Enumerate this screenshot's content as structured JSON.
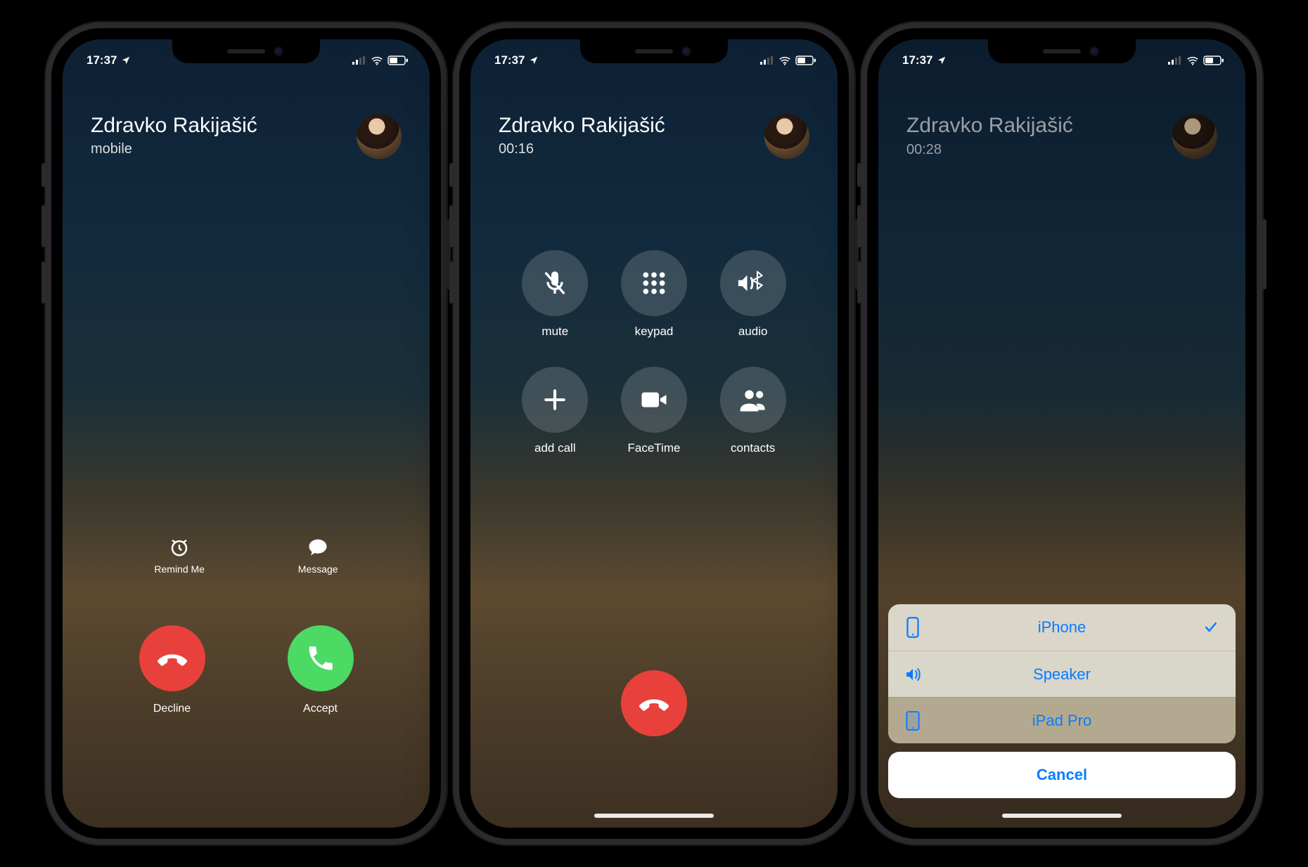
{
  "status": {
    "time": "17:37"
  },
  "screens": [
    {
      "caller_name": "Zdravko Rakijašić",
      "subtitle": "mobile",
      "remind_label": "Remind Me",
      "message_label": "Message",
      "decline_label": "Decline",
      "accept_label": "Accept"
    },
    {
      "caller_name": "Zdravko Rakijašić",
      "subtitle": "00:16",
      "cells": {
        "mute": "mute",
        "keypad": "keypad",
        "audio": "audio",
        "add_call": "add call",
        "facetime": "FaceTime",
        "contacts": "contacts"
      }
    },
    {
      "caller_name": "Zdravko Rakijašić",
      "subtitle": "00:28",
      "options": {
        "iphone": "iPhone",
        "speaker": "Speaker",
        "ipad": "iPad Pro",
        "cancel": "Cancel"
      }
    }
  ]
}
